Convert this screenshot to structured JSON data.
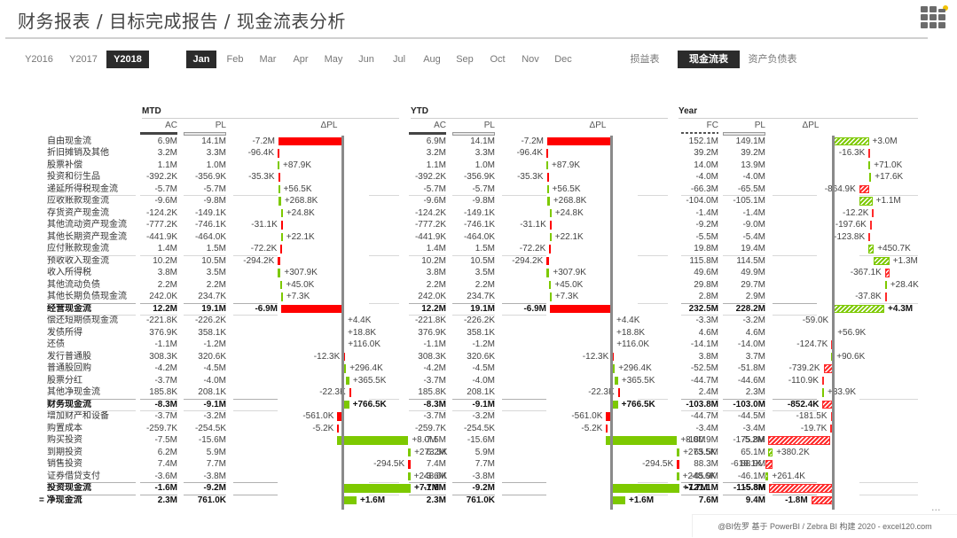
{
  "header": {
    "title": "财务报表 / 目标完成报告 / 现金流表分析",
    "logo_icon": "grid-apps-icon"
  },
  "nav": {
    "years": [
      {
        "label": "Y2016",
        "active": false
      },
      {
        "label": "Y2017",
        "active": false
      },
      {
        "label": "Y2018",
        "active": true
      }
    ],
    "months": [
      {
        "label": "Jan",
        "active": true
      },
      {
        "label": "Feb",
        "active": false
      },
      {
        "label": "Mar",
        "active": false
      },
      {
        "label": "Apr",
        "active": false
      },
      {
        "label": "May",
        "active": false
      },
      {
        "label": "Jun",
        "active": false
      },
      {
        "label": "Jul",
        "active": false
      },
      {
        "label": "Aug",
        "active": false
      },
      {
        "label": "Sep",
        "active": false
      },
      {
        "label": "Oct",
        "active": false
      },
      {
        "label": "Nov",
        "active": false
      },
      {
        "label": "Dec",
        "active": false
      }
    ],
    "reports": [
      {
        "label": "损益表",
        "active": false
      },
      {
        "label": "现金流表",
        "active": true
      },
      {
        "label": "资产负债表",
        "active": false
      }
    ]
  },
  "colors": {
    "positive": "#7dc900",
    "negative": "#ff0000",
    "active_bg": "#2b2b2b"
  },
  "rows": [
    {
      "label": "自由现金流",
      "bold": false
    },
    {
      "label": "折旧摊销及其他",
      "bold": false
    },
    {
      "label": "股票补偿",
      "bold": false
    },
    {
      "label": "投资和衍生品",
      "bold": false
    },
    {
      "label": "递延所得税现金流",
      "bold": false
    },
    {
      "label": "应收账款现金流",
      "bold": false
    },
    {
      "label": "存货资产现金流",
      "bold": false
    },
    {
      "label": "其他流动资产现金流",
      "bold": false
    },
    {
      "label": "其他长期资产现金流",
      "bold": false
    },
    {
      "label": "应付账款现金流",
      "bold": false
    },
    {
      "label": "预收收入现金流",
      "bold": false
    },
    {
      "label": "收入所得税",
      "bold": false
    },
    {
      "label": "其他流动负债",
      "bold": false
    },
    {
      "label": "其他长期负债现金流",
      "bold": false
    },
    {
      "label": "经营现金流",
      "bold": true
    },
    {
      "label": "偿还短期债现金流",
      "bold": false
    },
    {
      "label": "发债所得",
      "bold": false
    },
    {
      "label": "还债",
      "bold": false
    },
    {
      "label": "发行普通股",
      "bold": false
    },
    {
      "label": "普通股回购",
      "bold": false
    },
    {
      "label": "股票分红",
      "bold": false
    },
    {
      "label": "其他净现金流",
      "bold": false
    },
    {
      "label": "财务现金流",
      "bold": true
    },
    {
      "label": "增加财产和设备",
      "bold": false
    },
    {
      "label": "购置成本",
      "bold": false
    },
    {
      "label": "购买投资",
      "bold": false
    },
    {
      "label": "到期投资",
      "bold": false
    },
    {
      "label": "销售投资",
      "bold": false
    },
    {
      "label": "证券借贷支付",
      "bold": false
    },
    {
      "label": "投资现金流",
      "bold": true
    },
    {
      "label": "= 净现金流",
      "bold": true
    }
  ],
  "sections": {
    "mtd": {
      "title": "MTD",
      "col1": "AC",
      "col2": "PL",
      "delta_head": "ΔPL",
      "values": [
        [
          "6.9M",
          "14.1M",
          "-7.2M"
        ],
        [
          "3.2M",
          "3.3M",
          "-96.4K"
        ],
        [
          "1.1M",
          "1.0M",
          "+87.9K"
        ],
        [
          "-392.2K",
          "-356.9K",
          "-35.3K"
        ],
        [
          "-5.7M",
          "-5.7M",
          "+56.5K"
        ],
        [
          "-9.6M",
          "-9.8M",
          "+268.8K"
        ],
        [
          "-124.2K",
          "-149.1K",
          "+24.8K"
        ],
        [
          "-777.2K",
          "-746.1K",
          "-31.1K"
        ],
        [
          "-441.9K",
          "-464.0K",
          "+22.1K"
        ],
        [
          "1.4M",
          "1.5M",
          "-72.2K"
        ],
        [
          "10.2M",
          "10.5M",
          "-294.2K"
        ],
        [
          "3.8M",
          "3.5M",
          "+307.9K"
        ],
        [
          "2.2M",
          "2.2M",
          "+45.0K"
        ],
        [
          "242.0K",
          "234.7K",
          "+7.3K"
        ],
        [
          "12.2M",
          "19.1M",
          "-6.9M"
        ],
        [
          "-221.8K",
          "-226.2K",
          "+4.4K"
        ],
        [
          "376.9K",
          "358.1K",
          "+18.8K"
        ],
        [
          "-1.1M",
          "-1.2M",
          "+116.0K"
        ],
        [
          "308.3K",
          "320.6K",
          "-12.3K"
        ],
        [
          "-4.2M",
          "-4.5M",
          "+296.4K"
        ],
        [
          "-3.7M",
          "-4.0M",
          "+365.5K"
        ],
        [
          "185.8K",
          "208.1K",
          "-22.3K"
        ],
        [
          "-8.3M",
          "-9.1M",
          "+766.5K"
        ],
        [
          "-3.7M",
          "-3.2M",
          "-561.0K"
        ],
        [
          "-259.7K",
          "-254.5K",
          "-5.2K"
        ],
        [
          "-7.5M",
          "-15.6M",
          "+8.0M"
        ],
        [
          "6.2M",
          "5.9M",
          "+273.5K"
        ],
        [
          "7.4M",
          "7.7M",
          "-294.5K"
        ],
        [
          "-3.6M",
          "-3.8M",
          "+248.6K"
        ],
        [
          "-1.6M",
          "-9.2M",
          "+7.7M"
        ],
        [
          "2.3M",
          "761.0K",
          "+1.6M"
        ]
      ],
      "delta_k": [
        -7200,
        -96.4,
        87.9,
        -35.3,
        56.5,
        268.8,
        24.8,
        -31.1,
        22.1,
        -72.2,
        -294.2,
        307.9,
        45.0,
        7.3,
        -6900,
        4.4,
        18.8,
        116.0,
        -12.3,
        296.4,
        365.5,
        -22.3,
        766.5,
        -561.0,
        -5.2,
        8000,
        273.5,
        -294.5,
        248.6,
        7700,
        1600
      ]
    },
    "ytd": {
      "title": "YTD",
      "col1": "AC",
      "col2": "PL",
      "delta_head": "ΔPL",
      "values": [
        [
          "6.9M",
          "14.1M",
          "-7.2M"
        ],
        [
          "3.2M",
          "3.3M",
          "-96.4K"
        ],
        [
          "1.1M",
          "1.0M",
          "+87.9K"
        ],
        [
          "-392.2K",
          "-356.9K",
          "-35.3K"
        ],
        [
          "-5.7M",
          "-5.7M",
          "+56.5K"
        ],
        [
          "-9.6M",
          "-9.8M",
          "+268.8K"
        ],
        [
          "-124.2K",
          "-149.1K",
          "+24.8K"
        ],
        [
          "-777.2K",
          "-746.1K",
          "-31.1K"
        ],
        [
          "-441.9K",
          "-464.0K",
          "+22.1K"
        ],
        [
          "1.4M",
          "1.5M",
          "-72.2K"
        ],
        [
          "10.2M",
          "10.5M",
          "-294.2K"
        ],
        [
          "3.8M",
          "3.5M",
          "+307.9K"
        ],
        [
          "2.2M",
          "2.2M",
          "+45.0K"
        ],
        [
          "242.0K",
          "234.7K",
          "+7.3K"
        ],
        [
          "12.2M",
          "19.1M",
          "-6.9M"
        ],
        [
          "-221.8K",
          "-226.2K",
          "+4.4K"
        ],
        [
          "376.9K",
          "358.1K",
          "+18.8K"
        ],
        [
          "-1.1M",
          "-1.2M",
          "+116.0K"
        ],
        [
          "308.3K",
          "320.6K",
          "-12.3K"
        ],
        [
          "-4.2M",
          "-4.5M",
          "+296.4K"
        ],
        [
          "-3.7M",
          "-4.0M",
          "+365.5K"
        ],
        [
          "185.8K",
          "208.1K",
          "-22.3K"
        ],
        [
          "-8.3M",
          "-9.1M",
          "+766.5K"
        ],
        [
          "-3.7M",
          "-3.2M",
          "-561.0K"
        ],
        [
          "-259.7K",
          "-254.5K",
          "-5.2K"
        ],
        [
          "-7.5M",
          "-15.6M",
          "+8.0M"
        ],
        [
          "6.2M",
          "5.9M",
          "+273.5K"
        ],
        [
          "7.4M",
          "7.7M",
          "-294.5K"
        ],
        [
          "-3.6M",
          "-3.8M",
          "+248.6K"
        ],
        [
          "-1.6M",
          "-9.2M",
          "+7.7M"
        ],
        [
          "2.3M",
          "761.0K",
          "+1.6M"
        ]
      ],
      "delta_k": [
        -7200,
        -96.4,
        87.9,
        -35.3,
        56.5,
        268.8,
        24.8,
        -31.1,
        22.1,
        -72.2,
        -294.2,
        307.9,
        45.0,
        7.3,
        -6900,
        4.4,
        18.8,
        116.0,
        -12.3,
        296.4,
        365.5,
        -22.3,
        766.5,
        -561.0,
        -5.2,
        8000,
        273.5,
        -294.5,
        248.6,
        7700,
        1600
      ]
    },
    "year": {
      "title": "Year",
      "col1": "FC",
      "col2": "PL",
      "delta_head": "ΔPL",
      "values": [
        [
          "152.1M",
          "149.1M",
          "+3.0M"
        ],
        [
          "39.2M",
          "39.2M",
          "-16.3K"
        ],
        [
          "14.0M",
          "13.9M",
          "+71.0K"
        ],
        [
          "-4.0M",
          "-4.0M",
          "+17.6K"
        ],
        [
          "-66.3M",
          "-65.5M",
          "-864.9K"
        ],
        [
          "-104.0M",
          "-105.1M",
          "+1.1M"
        ],
        [
          "-1.4M",
          "-1.4M",
          "-12.2K"
        ],
        [
          "-9.2M",
          "-9.0M",
          "-197.6K"
        ],
        [
          "-5.5M",
          "-5.4M",
          "-123.8K"
        ],
        [
          "19.8M",
          "19.4M",
          "+450.7K"
        ],
        [
          "115.8M",
          "114.5M",
          "+1.3M"
        ],
        [
          "49.6M",
          "49.9M",
          "-367.1K"
        ],
        [
          "29.8M",
          "29.7M",
          "+28.4K"
        ],
        [
          "2.8M",
          "2.9M",
          "-37.8K"
        ],
        [
          "232.5M",
          "228.2M",
          "+4.3M"
        ],
        [
          "-3.3M",
          "-3.2M",
          "-59.0K"
        ],
        [
          "4.6M",
          "4.6M",
          "+56.9K"
        ],
        [
          "-14.1M",
          "-14.0M",
          "-124.7K"
        ],
        [
          "3.8M",
          "3.7M",
          "+90.6K"
        ],
        [
          "-52.5M",
          "-51.8M",
          "-739.2K"
        ],
        [
          "-44.7M",
          "-44.6M",
          "-110.9K"
        ],
        [
          "2.4M",
          "2.3M",
          "+33.9K"
        ],
        [
          "-103.8M",
          "-103.0M",
          "-852.4K"
        ],
        [
          "-44.7M",
          "-44.5M",
          "-181.5K"
        ],
        [
          "-3.4M",
          "-3.4M",
          "-19.7K"
        ],
        [
          "-180.9M",
          "-175.8M",
          "-5.2M"
        ],
        [
          "65.5M",
          "65.1M",
          "+380.2K"
        ],
        [
          "88.3M",
          "88.9M",
          "-618.1K"
        ],
        [
          "-45.9M",
          "-46.1M",
          "+261.4K"
        ],
        [
          "-121.1M",
          "-115.8M",
          "-5.3M"
        ],
        [
          "7.6M",
          "9.4M",
          "-1.8M"
        ]
      ],
      "delta_k": [
        3000,
        -16.3,
        71.0,
        17.6,
        -864.9,
        1100,
        -12.2,
        -197.6,
        -123.8,
        450.7,
        1300,
        -367.1,
        28.4,
        -37.8,
        4300,
        -59.0,
        56.9,
        -124.7,
        90.6,
        -739.2,
        -110.9,
        33.9,
        -852.4,
        -181.5,
        -19.7,
        -5200,
        380.2,
        -618.1,
        261.4,
        -5300,
        -1800
      ]
    }
  },
  "footer": {
    "more": "...",
    "credit": "@BI佐罗   基于 PowerBI / Zebra BI 构建 2020 - excel120.com"
  }
}
